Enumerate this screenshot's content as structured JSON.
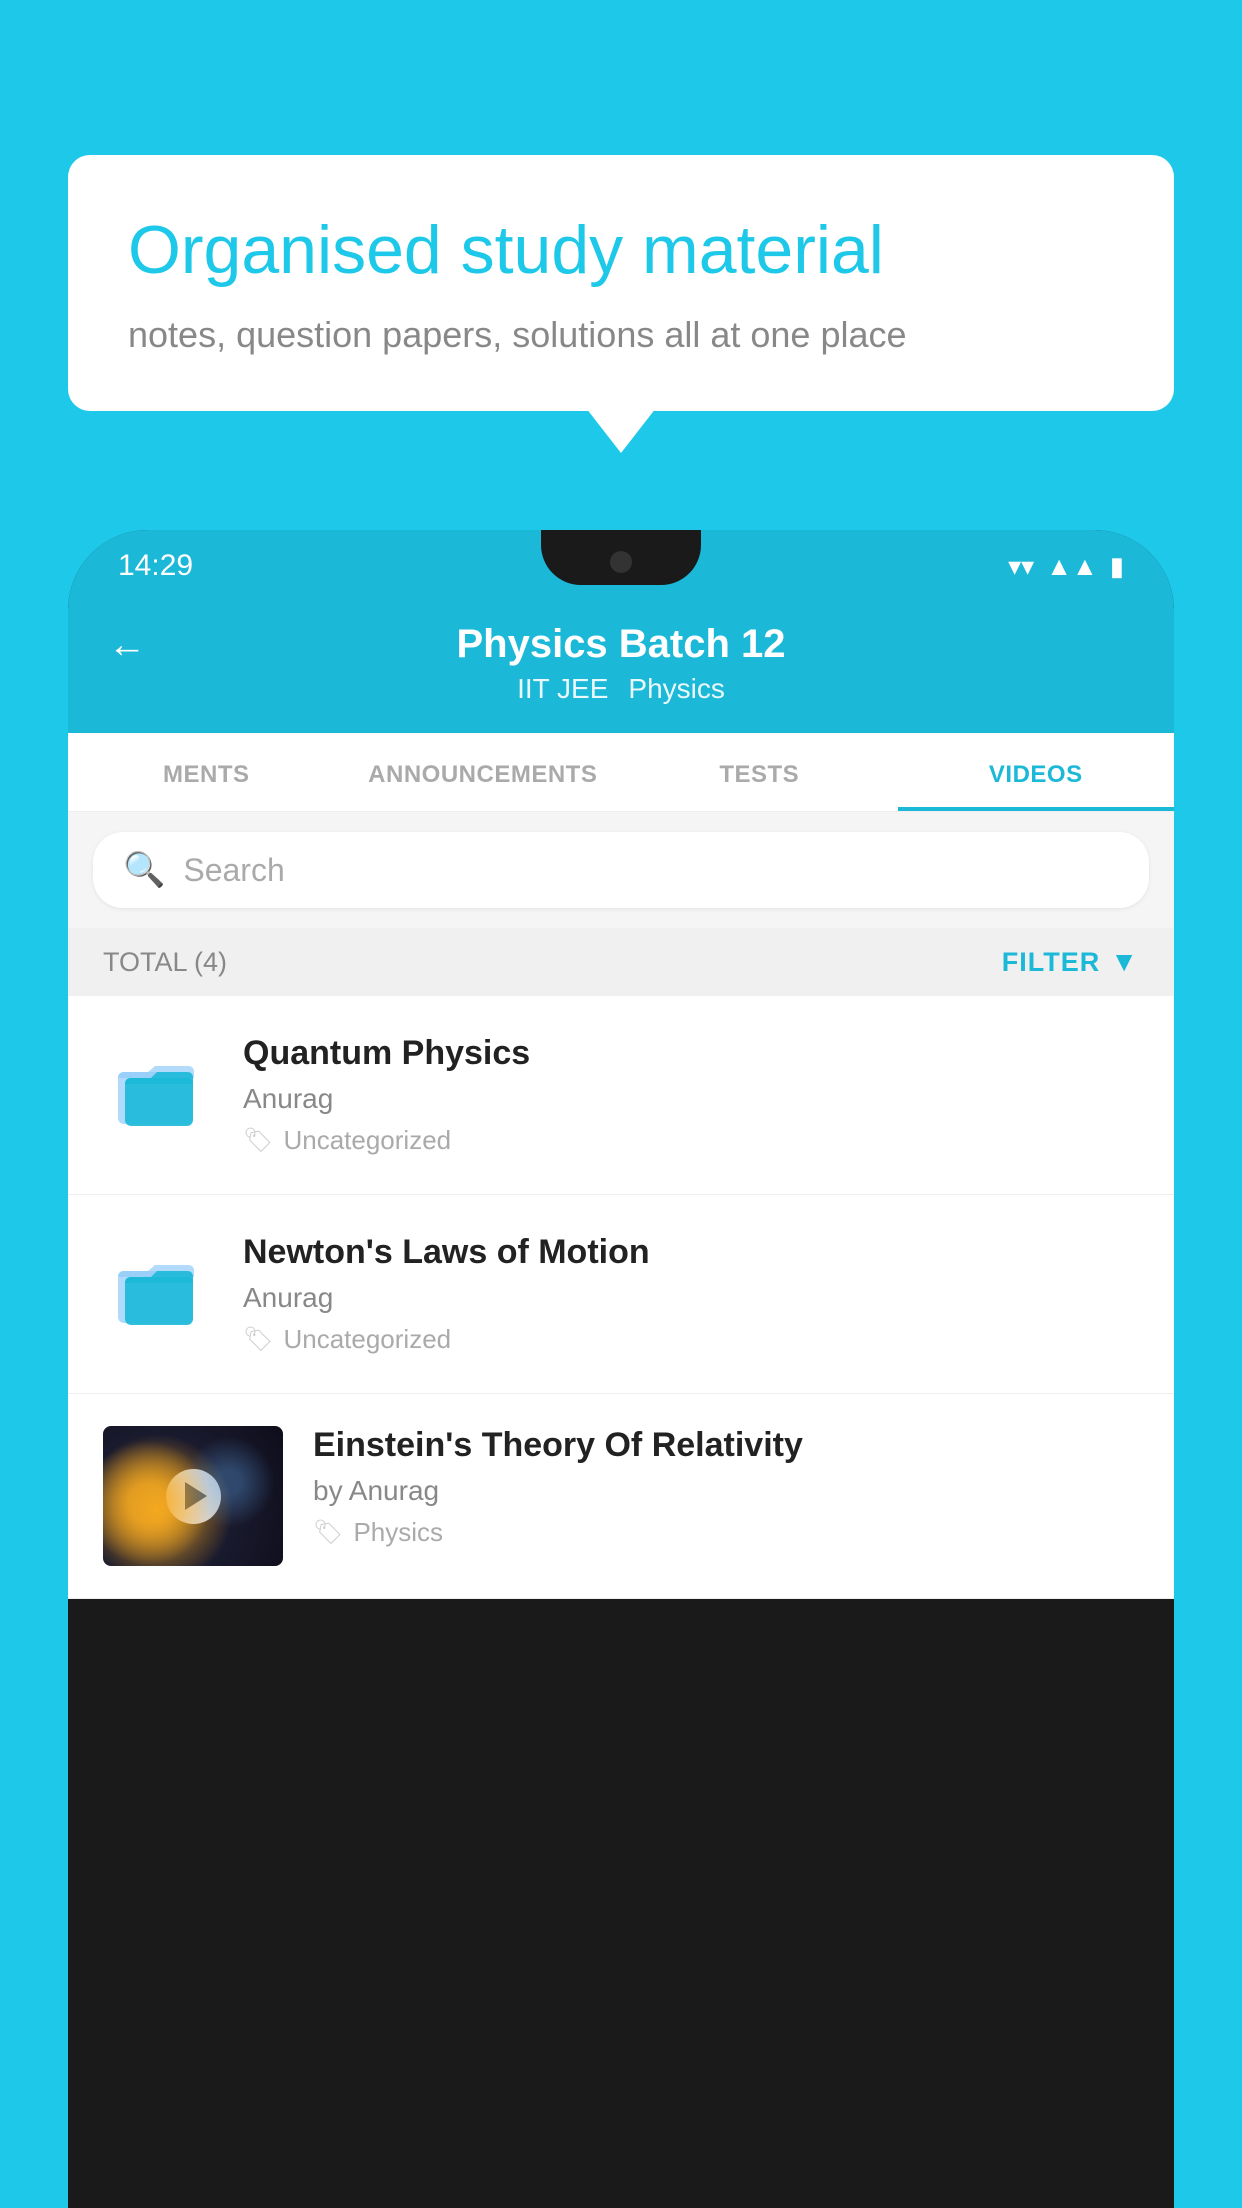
{
  "background": {
    "color": "#1EC8E8"
  },
  "speech_bubble": {
    "title": "Organised study material",
    "subtitle": "notes, question papers, solutions all at one place"
  },
  "status_bar": {
    "time": "14:29"
  },
  "app_header": {
    "back_label": "←",
    "title": "Physics Batch 12",
    "subtitle_part1": "IIT JEE",
    "subtitle_part2": "Physics"
  },
  "tabs": [
    {
      "label": "MENTS",
      "active": false
    },
    {
      "label": "ANNOUNCEMENTS",
      "active": false
    },
    {
      "label": "TESTS",
      "active": false
    },
    {
      "label": "VIDEOS",
      "active": true
    }
  ],
  "search": {
    "placeholder": "Search"
  },
  "filter_bar": {
    "total_label": "TOTAL (4)",
    "filter_label": "FILTER"
  },
  "videos": [
    {
      "id": 1,
      "title": "Quantum Physics",
      "author": "Anurag",
      "tag": "Uncategorized",
      "has_thumb": false
    },
    {
      "id": 2,
      "title": "Newton's Laws of Motion",
      "author": "Anurag",
      "tag": "Uncategorized",
      "has_thumb": false
    },
    {
      "id": 3,
      "title": "Einstein's Theory Of Relativity",
      "author": "by Anurag",
      "tag": "Physics",
      "has_thumb": true
    }
  ]
}
